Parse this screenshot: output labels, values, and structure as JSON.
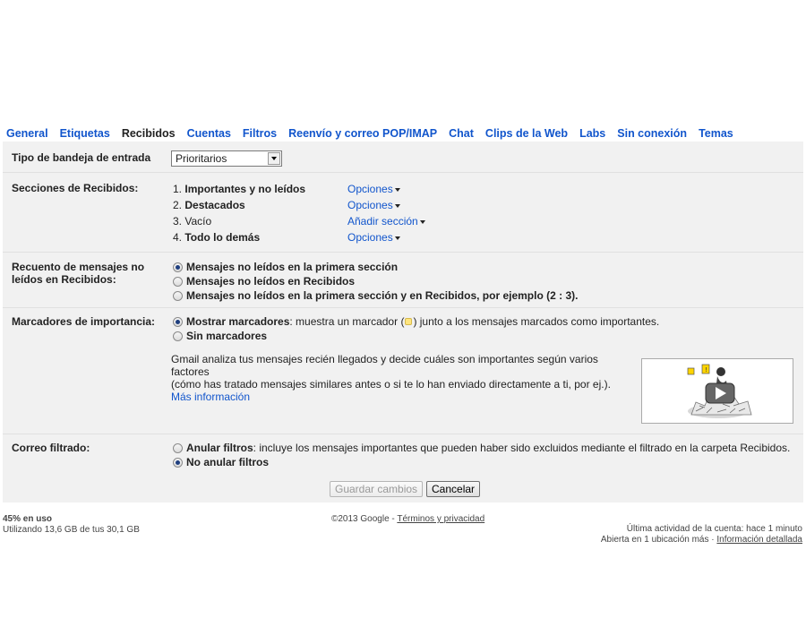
{
  "tabs": [
    {
      "label": "General",
      "active": false
    },
    {
      "label": "Etiquetas",
      "active": false
    },
    {
      "label": "Recibidos",
      "active": true
    },
    {
      "label": "Cuentas",
      "active": false
    },
    {
      "label": "Filtros",
      "active": false
    },
    {
      "label": "Reenvío y correo POP/IMAP",
      "active": false
    },
    {
      "label": "Chat",
      "active": false
    },
    {
      "label": "Clips de la Web",
      "active": false
    },
    {
      "label": "Labs",
      "active": false
    },
    {
      "label": "Sin conexión",
      "active": false
    },
    {
      "label": "Temas",
      "active": false
    }
  ],
  "inbox_type": {
    "label": "Tipo de bandeja de entrada",
    "selected": "Prioritarios"
  },
  "sections": {
    "label": "Secciones de Recibidos:",
    "items": [
      {
        "num": "1.",
        "name": "Importantes y no leídos",
        "bold": true,
        "option": "Opciones"
      },
      {
        "num": "2.",
        "name": "Destacados",
        "bold": true,
        "option": "Opciones"
      },
      {
        "num": "3.",
        "name": "Vacío",
        "bold": false,
        "option": "Añadir sección"
      },
      {
        "num": "4.",
        "name": "Todo lo demás",
        "bold": true,
        "option": "Opciones"
      }
    ]
  },
  "unread_count": {
    "label": "Recuento de mensajes no leídos en Recibidos:",
    "options": [
      {
        "text": "Mensajes no leídos en la primera sección",
        "checked": true
      },
      {
        "text": "Mensajes no leídos en Recibidos",
        "checked": false
      },
      {
        "text": "Mensajes no leídos en la primera sección y en Recibidos, por ejemplo (2 : 3).",
        "checked": false
      }
    ]
  },
  "importance": {
    "label": "Marcadores de importancia:",
    "show_bold": "Mostrar marcadores",
    "show_desc_pre": ": muestra un marcador (",
    "show_desc_post": ") junto a los mensajes marcados como importantes.",
    "hide_bold": "Sin marcadores",
    "show_checked": true,
    "description_line1": "Gmail analiza tus mensajes recién llegados y decide cuáles son importantes según varios factores",
    "description_line2": "(cómo has tratado mensajes similares antes o si te lo han enviado directamente a ti, por ej.).",
    "more_info": "Más información",
    "video_icon": "play-video-icon"
  },
  "filtered": {
    "label": "Correo filtrado:",
    "override_bold": "Anular filtros",
    "override_desc": ": incluye los mensajes importantes que pueden haber sido excluidos mediante el filtrado en la carpeta Recibidos.",
    "no_override_bold": "No anular filtros",
    "no_override_checked": true
  },
  "buttons": {
    "save": "Guardar cambios",
    "cancel": "Cancelar"
  },
  "footer": {
    "usage_percent": "45% en uso",
    "usage_detail": "Utilizando 13,6 GB de tus 30,1 GB",
    "copyright": "©2013 Google - ",
    "terms_link": "Términos y privacidad",
    "last_activity": "Última actividad de la cuenta: hace 1 minuto",
    "open_locations": "Abierta en 1 ubicación más · ",
    "details_link": "Información detallada"
  }
}
